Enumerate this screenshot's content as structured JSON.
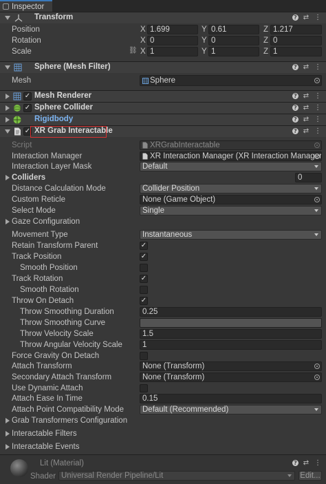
{
  "tab": {
    "label": "Inspector"
  },
  "transform": {
    "title": "Transform",
    "position_label": "Position",
    "rotation_label": "Rotation",
    "scale_label": "Scale",
    "axes": [
      "X",
      "Y",
      "Z"
    ],
    "position": [
      "1.699",
      "0.61",
      "1.217"
    ],
    "rotation": [
      "0",
      "0",
      "0"
    ],
    "scale": [
      "1",
      "1",
      "1"
    ]
  },
  "mesh_filter": {
    "title": "Sphere (Mesh Filter)",
    "mesh_label": "Mesh",
    "mesh_value": "Sphere"
  },
  "mesh_renderer": {
    "title": "Mesh Renderer"
  },
  "sphere_collider": {
    "title": "Sphere Collider"
  },
  "rigidbody": {
    "title": "Rigidbody"
  },
  "xr_grab": {
    "title": "XR Grab Interactable",
    "script_label": "Script",
    "script_value": "XRGrabInteractable",
    "interaction_manager_label": "Interaction Manager",
    "interaction_manager_value": "XR Interaction Manager (XR Interaction Manager)",
    "layer_mask_label": "Interaction Layer Mask",
    "layer_mask_value": "Default",
    "colliders_label": "Colliders",
    "colliders_count": "0",
    "distance_mode_label": "Distance Calculation Mode",
    "distance_mode_value": "Collider Position",
    "custom_reticle_label": "Custom Reticle",
    "custom_reticle_value": "None (Game Object)",
    "select_mode_label": "Select Mode",
    "select_mode_value": "Single",
    "gaze_config_label": "Gaze Configuration",
    "movement_type_label": "Movement Type",
    "movement_type_value": "Instantaneous",
    "retain_parent_label": "Retain Transform Parent",
    "retain_parent": true,
    "track_position_label": "Track Position",
    "track_position": true,
    "smooth_position_label": "Smooth Position",
    "smooth_position": false,
    "track_rotation_label": "Track Rotation",
    "track_rotation": true,
    "smooth_rotation_label": "Smooth Rotation",
    "smooth_rotation": false,
    "throw_on_detach_label": "Throw On Detach",
    "throw_on_detach": true,
    "throw_smoothing_duration_label": "Throw Smoothing Duration",
    "throw_smoothing_duration": "0.25",
    "throw_smoothing_curve_label": "Throw Smoothing Curve",
    "throw_velocity_scale_label": "Throw Velocity Scale",
    "throw_velocity_scale": "1.5",
    "throw_angular_label": "Throw Angular Velocity Scale",
    "throw_angular": "1",
    "force_gravity_label": "Force Gravity On Detach",
    "force_gravity": false,
    "attach_transform_label": "Attach Transform",
    "attach_transform_value": "None (Transform)",
    "secondary_attach_label": "Secondary Attach Transform",
    "secondary_attach_value": "None (Transform)",
    "dynamic_attach_label": "Use Dynamic Attach",
    "dynamic_attach": false,
    "ease_in_label": "Attach Ease In Time",
    "ease_in_value": "0.15",
    "compat_mode_label": "Attach Point Compatibility Mode",
    "compat_mode_value": "Default (Recommended)",
    "grab_transformers_label": "Grab Transformers Configuration",
    "filters_label": "Interactable Filters",
    "events_label": "Interactable Events"
  },
  "material": {
    "title": "Lit (Material)",
    "shader_label": "Shader",
    "shader_value": "Universal Render Pipeline/Lit",
    "edit_label": "Edit..."
  },
  "colors": {
    "accent": "#3a79bb",
    "highlight": "#d83030",
    "rigidbody_title": "#7cb3f0"
  }
}
